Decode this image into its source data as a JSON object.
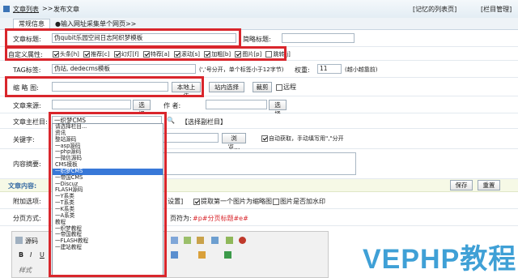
{
  "header": {
    "breadcrumb_home": "文章列表",
    "breadcrumb_sep": ">>",
    "breadcrumb_page": "发布文章",
    "link_recent": "[记忆的列表页]",
    "link_column": "[栏目管理]"
  },
  "tabs": [
    "常规信息",
    "●输入网址采集单个网页>>"
  ],
  "form": {
    "title_label": "文章标题:",
    "title_value": "伪qubit乐园空间日志阿织梦模板",
    "short_title_label": "简略标题:",
    "attr_label": "自定义属性:",
    "attrs": [
      "头条[h]",
      "推荐[c]",
      "幻灯[f]",
      "特荐[a]",
      "滚动[s]",
      "加粗[b]",
      "图片[p]",
      "跳转[j]"
    ],
    "tag_label": "TAG标签:",
    "tag_value": "伪站, dedecms模板",
    "tag_hint": "(','号分开，单个标签小于12字节)",
    "weight_label": "权重:",
    "weight_value": "11",
    "weight_hint": "(越小越靠前)",
    "thumb_label": "缩 略 图:",
    "upload_btn": "本地上传",
    "site_select_btn": "站内选择",
    "crop_btn": "裁剪",
    "remote_label": "远程",
    "source_label": "文章来源:",
    "source_btn": "选择",
    "author_label": "作 者:",
    "author_btn": "选择",
    "column_label": "文章主栏目:",
    "column_value": "一织梦CMS",
    "column_sub_link": "【选择副栏目】",
    "keywords_label": "关键字:",
    "browse_btn": "浏览...",
    "auto_label": "自动获取，手动填写用\",\"分开",
    "summary_label": "内容摘要:",
    "content_label": "文章内容:",
    "save_btn": "保存",
    "reset_btn": "重置",
    "extra_label": "附加选项:",
    "extra_setting": "[设置]",
    "extra_first_img": "提取第一个图片为缩略图",
    "extra_watermark": "图片是否加水印",
    "paging_label": "分页方式:",
    "paging_sep_prefix": "页符为:",
    "paging_sep_value": "#p#分页标题#e#",
    "editor_source": "源码"
  },
  "dropdown": {
    "options": [
      "请选择栏目...",
      "资讯",
      "整站源码",
      "一asp源码",
      "一php源码",
      "一微信源码",
      "CMS模板",
      "一织梦CMS",
      "一帝国CMS",
      "一Discuz",
      "FLASH源码",
      "一Y系类",
      "一T系类",
      "一K系类",
      "一A系类",
      "教程",
      "一织梦教程",
      "一帝国教程",
      "一FLASH教程",
      "一建站教程"
    ],
    "selected": "一织梦CMS"
  },
  "watermark": "VEPHP教程"
}
